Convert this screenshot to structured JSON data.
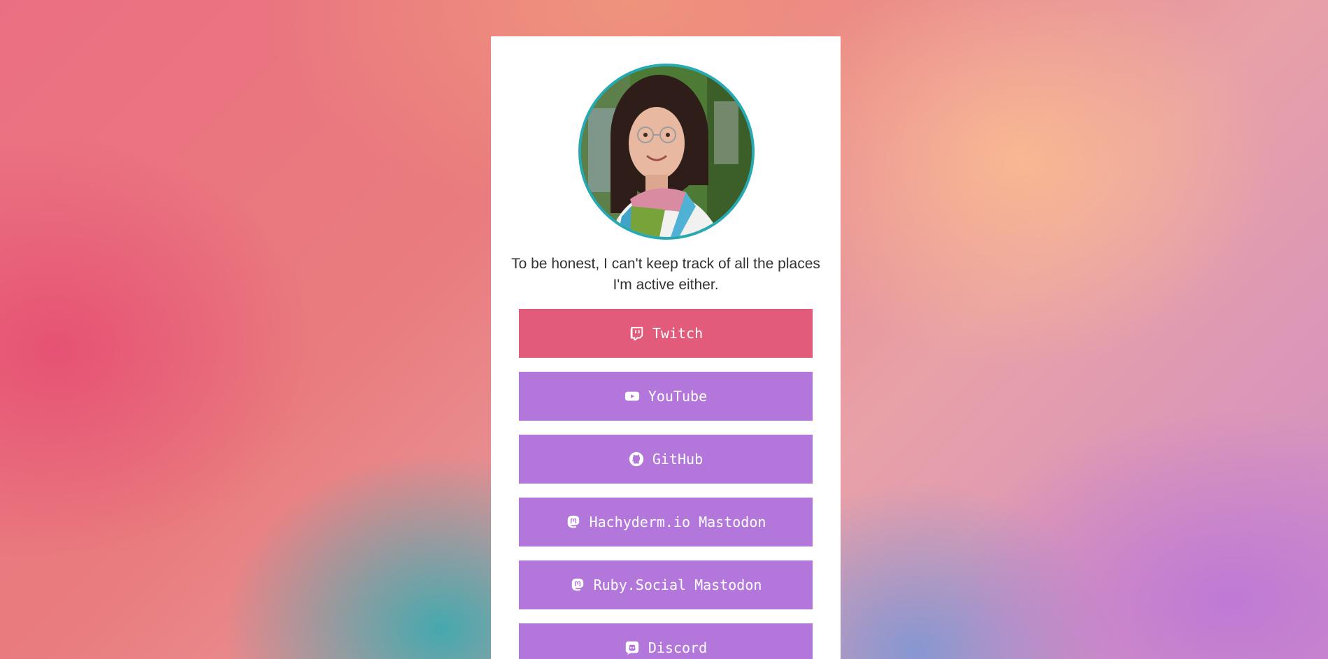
{
  "profile": {
    "avatar_alt": "profile photo",
    "avatar_border_color": "#26a9b3",
    "bio_line1": "To be honest, I can't keep track of all the places",
    "bio_line2": "I'm active either."
  },
  "links": [
    {
      "label": "Twitch",
      "icon": "twitch-icon",
      "color": "#e35b7a"
    },
    {
      "label": "YouTube",
      "icon": "youtube-icon",
      "color": "#b377dc"
    },
    {
      "label": "GitHub",
      "icon": "github-icon",
      "color": "#b377dc"
    },
    {
      "label": "Hachyderm.io Mastodon",
      "icon": "mastodon-icon",
      "color": "#b377dc"
    },
    {
      "label": "Ruby.Social Mastodon",
      "icon": "mastodon-icon",
      "color": "#b377dc"
    },
    {
      "label": "Discord",
      "icon": "discord-icon",
      "color": "#b377dc"
    }
  ]
}
